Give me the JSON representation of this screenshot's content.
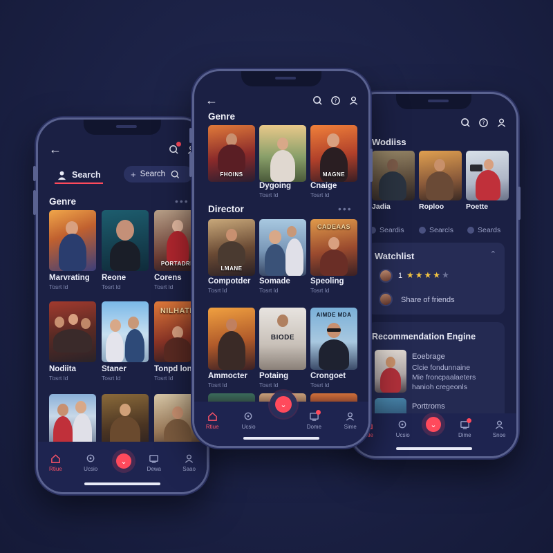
{
  "left_phone": {
    "search_tab_label": "Search",
    "search_button_label": "Search",
    "genre_title": "Genre",
    "movies": [
      {
        "title": "Marvrating",
        "sub": "Tosrt ld",
        "poster_text": ""
      },
      {
        "title": "Reone",
        "sub": "Tosrt ld",
        "poster_text": ""
      },
      {
        "title": "Corens",
        "sub": "Tosrt ld",
        "poster_text": "PORTADRE"
      },
      {
        "title": "Nodiita",
        "sub": "Tosrt ld",
        "poster_text": ""
      },
      {
        "title": "Staner",
        "sub": "Tosrt ld",
        "poster_text": ""
      },
      {
        "title": "Tonpd lon:",
        "sub": "Tosrt ld",
        "poster_text": "NILHATE"
      },
      {
        "title": "",
        "sub": "",
        "poster_text": ""
      },
      {
        "title": "",
        "sub": "",
        "poster_text": ""
      },
      {
        "title": "",
        "sub": "",
        "poster_text": ""
      }
    ],
    "nav": [
      {
        "label": "Rtiue",
        "icon": "home-icon",
        "active": true
      },
      {
        "label": "Ucsio",
        "icon": "explore-icon",
        "active": false
      },
      {
        "label": "Dewa",
        "icon": "screen-icon",
        "active": false
      },
      {
        "label": "Saao",
        "icon": "profile-icon",
        "active": false
      }
    ]
  },
  "center_phone": {
    "genre_title": "Genre",
    "director_title": "Director",
    "genre_movies": [
      {
        "title": "",
        "sub": "",
        "poster_text": "FHOINS"
      },
      {
        "title": "Dygoing",
        "sub": "Tosrt ld",
        "poster_text": ""
      },
      {
        "title": "Cnaige",
        "sub": "Tosrt ld",
        "poster_text": "MAGNE"
      }
    ],
    "director_movies": [
      {
        "title": "Compotder",
        "sub": "Tosrt ld",
        "poster_text": "LMANE"
      },
      {
        "title": "Somade",
        "sub": "Tosrt ld",
        "poster_text": ""
      },
      {
        "title": "Speoling",
        "sub": "Tosrt ld",
        "poster_text": "CADEAAS"
      },
      {
        "title": "Ammocter",
        "sub": "Tosrt ld",
        "poster_text": ""
      },
      {
        "title": "Potaing",
        "sub": "Tosrt ld",
        "poster_text": "BIODE"
      },
      {
        "title": "Crongoet",
        "sub": "Tosrt ld",
        "poster_text": "AIMDE MDA"
      }
    ],
    "nav": [
      {
        "label": "Rtiue",
        "icon": "home-icon",
        "active": true
      },
      {
        "label": "Ucsio",
        "icon": "explore-icon",
        "active": false
      },
      {
        "label": "Dome",
        "icon": "screen-icon",
        "active": false
      },
      {
        "label": "Sime",
        "icon": "profile-icon",
        "active": false
      }
    ]
  },
  "right_phone": {
    "wodiiss_title": "Wodiiss",
    "movies": [
      {
        "title": "Jadia"
      },
      {
        "title": "Roploo"
      },
      {
        "title": "Poette"
      }
    ],
    "chips": [
      "Seardis",
      "Searcls",
      "Seards"
    ],
    "watchlist_title": "Watchlist",
    "rating_number": "1",
    "rating": 4,
    "share_label": "Share of friends",
    "rec_title": "Recommendation Engine",
    "rec_item_title": "Eoebrage",
    "rec_item_desc_1": "Clcie fondunnaine",
    "rec_item_desc_2": "Mie froncpaalaeters",
    "rec_item_desc_3": "hanioh cregeonls",
    "rec_item2_title": "Porttroms",
    "nav": [
      {
        "label": "Rtie",
        "icon": "home-icon",
        "active": true
      },
      {
        "label": "Ucsio",
        "icon": "explore-icon",
        "active": false
      },
      {
        "label": "Dime",
        "icon": "screen-icon",
        "active": false
      },
      {
        "label": "Snoe",
        "icon": "profile-icon",
        "active": false
      }
    ]
  },
  "colors": {
    "accent": "#ff4a5c",
    "background": "#1b2145",
    "card": "#262c55",
    "star": "#f4c542"
  }
}
